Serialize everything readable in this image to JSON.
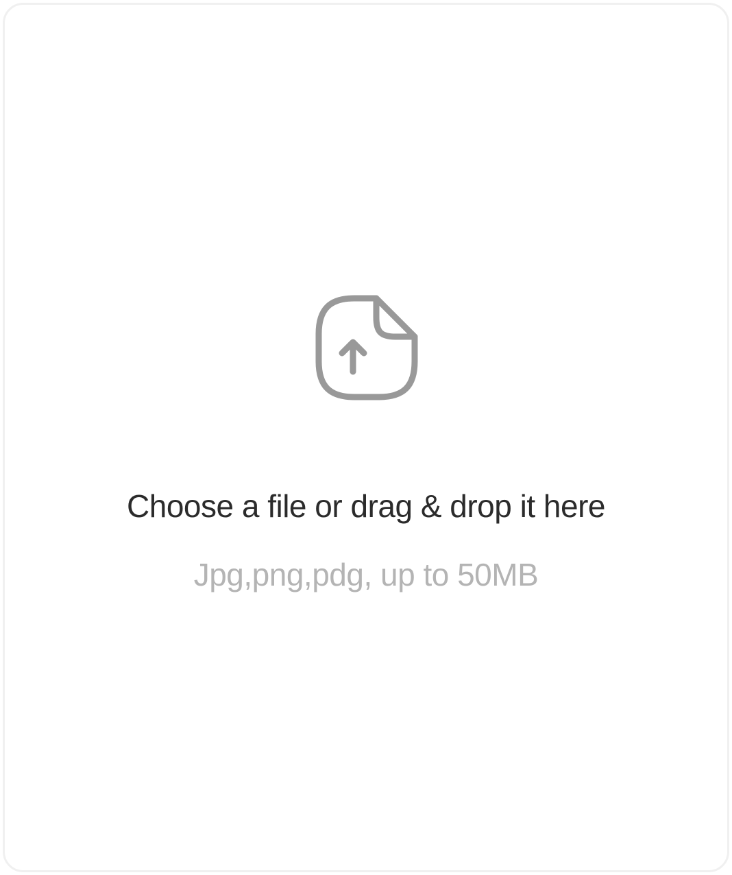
{
  "dropzone": {
    "icon": "file-upload-icon",
    "title": "Choose a file or drag & drop it here",
    "hint": "Jpg,png,pdg, up to 50MB"
  },
  "colors": {
    "border": "#f0f0f0",
    "icon": "#999999",
    "title": "#2b2b2b",
    "hint": "#b4b4b4",
    "background": "#ffffff"
  }
}
